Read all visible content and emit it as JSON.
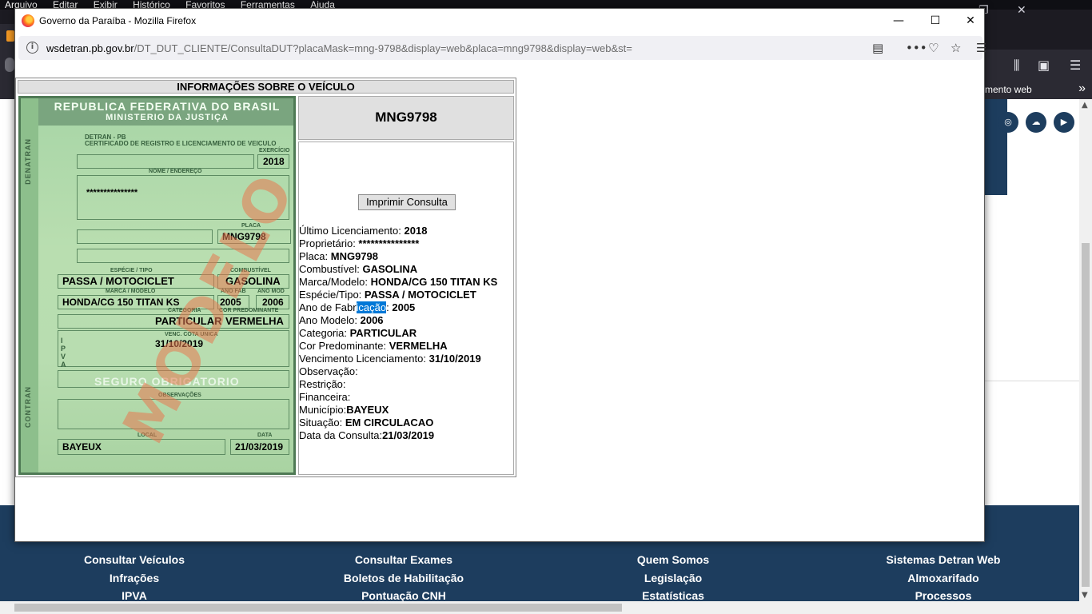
{
  "background": {
    "menubar": [
      "Arquivo",
      "Editar",
      "Exibir",
      "Histórico",
      "Favoritos",
      "Ferramentas",
      "Ajuda"
    ],
    "bookmarks_label": "mento web",
    "footer": {
      "col1": [
        "Consultar Veículos",
        "Infrações",
        "IPVA"
      ],
      "col2": [
        "Consultar Exames",
        "Boletos de Habilitação",
        "Pontuação CNH"
      ],
      "col3": [
        "Quem Somos",
        "Legislação",
        "Estatísticas"
      ],
      "col4": [
        "Sistemas Detran Web",
        "Almoxarifado",
        "Processos"
      ]
    }
  },
  "popup": {
    "window_title": "Governo da Paraíba - Mozilla Firefox",
    "url_host": "wsdetran.pb.gov.br",
    "url_path": "/DT_DUT_CLIENTE/ConsultaDUT?placaMask=mng-9798&display=web&placa=mng9798&display=web&st="
  },
  "vehicle": {
    "header": "INFORMAÇÕES SOBRE O VEÍCULO",
    "plate_title": "MNG9798",
    "print_button": "Imprimir Consulta",
    "lines": [
      {
        "label": "Último Licenciamento: ",
        "value": "2018"
      },
      {
        "label": "Proprietário: ",
        "value": "***************"
      },
      {
        "label": "Placa: ",
        "value": "MNG9798"
      },
      {
        "label": "Combustível: ",
        "value": "GASOLINA"
      },
      {
        "label": "Marca/Modelo: ",
        "value": "HONDA/CG 150 TITAN KS"
      },
      {
        "label": "Espécie/Tipo: ",
        "value": "PASSA / MOTOCICLET"
      },
      {
        "label": "Ano de Fabricação: ",
        "value": "2005"
      },
      {
        "label": "Ano Modelo: ",
        "value": "2006"
      },
      {
        "label": "Categoria: ",
        "value": "PARTICULAR"
      },
      {
        "label": "Cor Predominante: ",
        "value": "VERMELHA"
      },
      {
        "label": "Vencimento Licenciamento: ",
        "value": "31/10/2019"
      },
      {
        "label": "Observação:",
        "value": ""
      },
      {
        "label": "Restrição:",
        "value": ""
      },
      {
        "label": "Financeira:",
        "value": ""
      },
      {
        "label": "Município:",
        "value": "BAYEUX"
      },
      {
        "label": "Situação: ",
        "value": "EM CIRCULACAO"
      },
      {
        "label": "Data da Consulta:",
        "value": "21/03/2019"
      }
    ],
    "selected_text_line": "Ano de Fabricação: "
  },
  "document": {
    "republic": "REPUBLICA FEDERATIVA DO BRASIL",
    "ministry": "MINISTERIO DA JUSTIÇA",
    "detran": "DETRAN - PB",
    "certificate": "CERTIFICADO DE REGISTRO E LICENCIAMENTO DE VEICULO",
    "exercicio_label": "EXERCÍCIO",
    "exercicio": "2018",
    "nome_label": "NOME / ENDEREÇO",
    "owner": "***************",
    "placa_label": "PLACA",
    "placa": "MNG9798",
    "especie_label": "ESPÉCIE / TIPO",
    "especie": "PASSA / MOTOCICLET",
    "combustivel_label": "COMBUSTÍVEL",
    "combustivel": "GASOLINA",
    "marca_label": "MARCA / MODELO",
    "marca": "HONDA/CG 150 TITAN KS",
    "ano_fab_label": "ANO FAB",
    "ano_fab": "2005",
    "ano_mod_label": "ANO MOD",
    "ano_mod": "2006",
    "categoria_label": "CATEGORIA",
    "categoria": "PARTICULAR",
    "cor_label": "COR PREDOMINANTE",
    "cor": "VERMELHA",
    "venc_label": "VENC. COTA UNICA",
    "venc": "31/10/2019",
    "seguro": "SEGURO OBRIGATORIO",
    "obs_label": "OBSERVAÇÕES",
    "local_label": "LOCAL",
    "local": "BAYEUX",
    "data_label": "DATA",
    "data": "21/03/2019",
    "watermark": "MODELO"
  }
}
